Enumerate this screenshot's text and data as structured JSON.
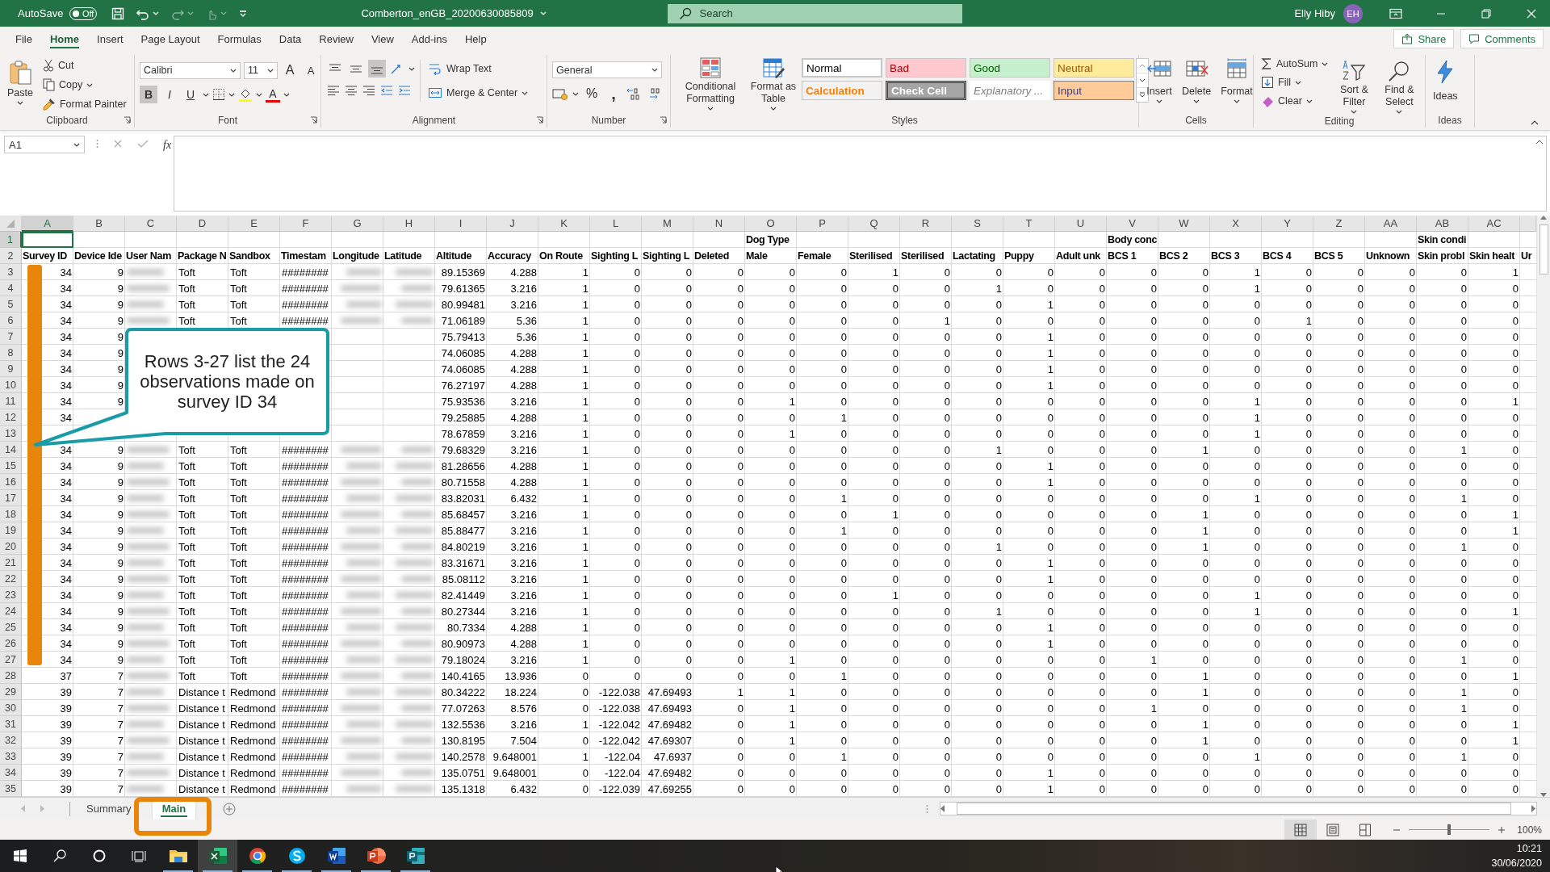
{
  "title_bar": {
    "autosave_label": "AutoSave",
    "autosave": {
      "label": "Off",
      "on": false
    },
    "file_name": "Comberton_enGB_20200630085809",
    "search": {
      "placeholder": "Search"
    },
    "user": {
      "name": "Elly Hiby",
      "initials": "EH"
    }
  },
  "tabs": [
    {
      "label": "File",
      "selected": false
    },
    {
      "label": "Home",
      "selected": true
    },
    {
      "label": "Insert",
      "selected": false
    },
    {
      "label": "Page Layout",
      "selected": false
    },
    {
      "label": "Formulas",
      "selected": false
    },
    {
      "label": "Data",
      "selected": false
    },
    {
      "label": "Review",
      "selected": false
    },
    {
      "label": "View",
      "selected": false
    },
    {
      "label": "Add-ins",
      "selected": false
    },
    {
      "label": "Help",
      "selected": false
    }
  ],
  "share_button": "Share",
  "comments_button": "Comments",
  "ribbon": {
    "groups": [
      {
        "kind": "clipboard",
        "label": "Clipboard",
        "paste": "Paste",
        "cut": "Cut",
        "copy": "Copy",
        "format_painter": "Format Painter"
      },
      {
        "kind": "font",
        "label": "Font",
        "font_name": "Calibri",
        "font_size": "11",
        "grow": "A",
        "shrink": "A",
        "format_buttons": [
          {
            "label": "B",
            "selected": true
          },
          {
            "label": "I",
            "selected": false
          },
          {
            "label": "U",
            "selected": false
          }
        ],
        "font_color": "A"
      },
      {
        "kind": "alignment",
        "label": "Alignment",
        "vertical_align": [
          {
            "selected": false
          },
          {
            "selected": false
          },
          {
            "selected": true
          }
        ],
        "wrap_text": "Wrap Text",
        "merge_center": "Merge & Center"
      },
      {
        "kind": "number",
        "label": "Number",
        "format": "General",
        "percent": "%",
        "comma": ","
      },
      {
        "kind": "styles",
        "label": "Styles",
        "conditional_formatting": "Conditional Formatting",
        "format_as_table": "Format as Table",
        "cell_styles": [
          {
            "label": "Normal",
            "color": "#ffffff"
          },
          {
            "label": "Bad",
            "color": "#ffc7ce"
          },
          {
            "label": "Good",
            "color": "#c6efce"
          },
          {
            "label": "Neutral",
            "color": "#ffeb9c"
          },
          {
            "label": "Calculation",
            "color": "#f2f2f2"
          },
          {
            "label": "Check Cell",
            "color": "#a5a5a5"
          },
          {
            "label": "Explanatory ...",
            "color": "#ffffff"
          },
          {
            "label": "Input",
            "color": "#ffcc99"
          }
        ]
      },
      {
        "kind": "cells",
        "label": "Cells",
        "buttons": [
          "Insert",
          "Delete",
          "Format"
        ]
      },
      {
        "kind": "editing",
        "label": "Editing",
        "autosum": "AutoSum",
        "fill": "Fill",
        "clear": "Clear",
        "sort_filter": "Sort & Filter",
        "find_select": "Find & Select"
      },
      {
        "kind": "ideas",
        "label": "Ideas",
        "button": "Ideas"
      }
    ]
  },
  "formula_bar": {
    "name_box": "A1",
    "fx": "fx"
  },
  "grid": {
    "columns": [
      {
        "letter": "A",
        "selected": true,
        "numeric": true
      },
      {
        "letter": "B",
        "selected": false,
        "numeric": true
      },
      {
        "letter": "C",
        "selected": false,
        "redacted": true
      },
      {
        "letter": "D",
        "selected": false,
        "numeric": false
      },
      {
        "letter": "E",
        "selected": false,
        "numeric": false
      },
      {
        "letter": "F",
        "selected": false,
        "numeric": false
      },
      {
        "letter": "G",
        "selected": false,
        "redacted": true,
        "numeric": true
      },
      {
        "letter": "H",
        "selected": false,
        "redacted": true,
        "numeric": true
      },
      {
        "letter": "I",
        "selected": false,
        "numeric": true
      },
      {
        "letter": "J",
        "selected": false,
        "numeric": true
      },
      {
        "letter": "K",
        "selected": false,
        "numeric": true
      },
      {
        "letter": "L",
        "selected": false,
        "numeric": true
      },
      {
        "letter": "M",
        "selected": false,
        "numeric": true
      },
      {
        "letter": "N",
        "selected": false,
        "numeric": true
      },
      {
        "letter": "O",
        "selected": false,
        "numeric": true
      },
      {
        "letter": "P",
        "selected": false,
        "numeric": true
      },
      {
        "letter": "Q",
        "selected": false,
        "numeric": true
      },
      {
        "letter": "R",
        "selected": false,
        "numeric": true
      },
      {
        "letter": "S",
        "selected": false,
        "numeric": true
      },
      {
        "letter": "T",
        "selected": false,
        "numeric": true
      },
      {
        "letter": "U",
        "selected": false,
        "numeric": true
      },
      {
        "letter": "V",
        "selected": false,
        "numeric": true
      },
      {
        "letter": "W",
        "selected": false,
        "numeric": true
      },
      {
        "letter": "X",
        "selected": false,
        "numeric": true
      },
      {
        "letter": "Y",
        "selected": false,
        "numeric": true
      },
      {
        "letter": "Z",
        "selected": false,
        "numeric": true
      },
      {
        "letter": "AA",
        "selected": false,
        "numeric": true
      },
      {
        "letter": "AB",
        "selected": false,
        "numeric": true
      },
      {
        "letter": "AC",
        "selected": false,
        "numeric": true
      },
      {
        "selected": false
      }
    ],
    "rows": [
      {
        "number": "1",
        "selected": true,
        "kind": "header",
        "cells": [
          null,
          null,
          null,
          null,
          null,
          null,
          null,
          null,
          null,
          null,
          null,
          null,
          null,
          null,
          "Dog Type",
          null,
          null,
          null,
          null,
          null,
          null,
          "Body conc",
          null,
          null,
          null,
          null,
          null,
          "Skin condi",
          null,
          null
        ]
      },
      {
        "number": "2",
        "selected": false,
        "kind": "header",
        "cells": [
          "Survey ID",
          "Device Ide",
          "User Nam",
          "Package N",
          "Sandbox",
          "Timestam",
          "Longitude",
          "Latitude",
          "Altitude",
          "Accuracy",
          "On Route",
          "Sighting L",
          "Sighting L",
          "Deleted",
          "Male",
          "Female",
          "Sterilised",
          "Sterilised",
          "Lactating",
          "Puppy",
          "Adult unk",
          "BCS 1",
          "BCS 2",
          "BCS 3",
          "BCS 4",
          "BCS 5",
          "Unknown",
          "Skin probl",
          "Skin healt",
          "Ur"
        ]
      },
      {
        "number": "3",
        "selected": false,
        "kind": "data",
        "cells": [
          "34",
          "9",
          null,
          "Toft",
          "Toft",
          "########",
          null,
          null,
          "89.15369",
          "4.288",
          "1",
          "0",
          "0",
          "0",
          "0",
          "0",
          "1",
          "0",
          "0",
          "0",
          "0",
          "0",
          "0",
          "1",
          "0",
          "0",
          "0",
          "0",
          "1",
          null
        ]
      },
      {
        "number": "4",
        "selected": false,
        "kind": "data",
        "cells": [
          "34",
          "9",
          null,
          "Toft",
          "Toft",
          "########",
          null,
          null,
          "79.61365",
          "3.216",
          "1",
          "0",
          "0",
          "0",
          "0",
          "0",
          "0",
          "0",
          "1",
          "0",
          "0",
          "0",
          "0",
          "1",
          "0",
          "0",
          "0",
          "0",
          "0",
          null
        ]
      },
      {
        "number": "5",
        "selected": false,
        "kind": "data",
        "cells": [
          "34",
          "9",
          null,
          "Toft",
          "Toft",
          "########",
          null,
          null,
          "80.99481",
          "3.216",
          "1",
          "0",
          "0",
          "0",
          "0",
          "0",
          "0",
          "0",
          "0",
          "1",
          "0",
          "0",
          "0",
          "0",
          "0",
          "0",
          "0",
          "0",
          "0",
          null
        ]
      },
      {
        "number": "6",
        "selected": false,
        "kind": "data",
        "cells": [
          "34",
          "9",
          null,
          "Toft",
          "Toft",
          "########",
          null,
          null,
          "71.06189",
          "5.36",
          "1",
          "0",
          "0",
          "0",
          "0",
          "0",
          "0",
          "1",
          "0",
          "0",
          "0",
          "0",
          "0",
          "0",
          "1",
          "0",
          "0",
          "0",
          "0",
          null
        ]
      },
      {
        "number": "7",
        "selected": false,
        "kind": "data",
        "cells": [
          "34",
          "9",
          null,
          null,
          null,
          null,
          null,
          null,
          "75.79413",
          "5.36",
          "1",
          "0",
          "0",
          "0",
          "0",
          "0",
          "0",
          "0",
          "0",
          "1",
          "0",
          "0",
          "0",
          "0",
          "0",
          "0",
          "0",
          "0",
          "0",
          null
        ]
      },
      {
        "number": "8",
        "selected": false,
        "kind": "data",
        "cells": [
          "34",
          "9",
          null,
          null,
          null,
          null,
          null,
          null,
          "74.06085",
          "4.288",
          "1",
          "0",
          "0",
          "0",
          "0",
          "0",
          "0",
          "0",
          "0",
          "1",
          "0",
          "0",
          "0",
          "0",
          "0",
          "0",
          "0",
          "0",
          "0",
          null
        ]
      },
      {
        "number": "9",
        "selected": false,
        "kind": "data",
        "cells": [
          "34",
          "9",
          null,
          null,
          null,
          null,
          null,
          null,
          "74.06085",
          "4.288",
          "1",
          "0",
          "0",
          "0",
          "0",
          "0",
          "0",
          "0",
          "0",
          "1",
          "0",
          "0",
          "0",
          "0",
          "0",
          "0",
          "0",
          "0",
          "0",
          null
        ]
      },
      {
        "number": "10",
        "selected": false,
        "kind": "data",
        "cells": [
          "34",
          "9",
          null,
          null,
          null,
          null,
          null,
          null,
          "76.27197",
          "4.288",
          "1",
          "0",
          "0",
          "0",
          "0",
          "0",
          "0",
          "0",
          "0",
          "1",
          "0",
          "0",
          "0",
          "0",
          "0",
          "0",
          "0",
          "0",
          "0",
          null
        ]
      },
      {
        "number": "11",
        "selected": false,
        "kind": "data",
        "cells": [
          "34",
          "9",
          null,
          null,
          null,
          null,
          null,
          null,
          "75.93536",
          "3.216",
          "1",
          "0",
          "0",
          "0",
          "1",
          "0",
          "0",
          "0",
          "0",
          "0",
          "0",
          "0",
          "0",
          "1",
          "0",
          "0",
          "0",
          "0",
          "1",
          null
        ]
      },
      {
        "number": "12",
        "selected": false,
        "kind": "data",
        "cells": [
          "34",
          null,
          null,
          null,
          null,
          null,
          null,
          null,
          "79.25885",
          "4.288",
          "1",
          "0",
          "0",
          "0",
          "0",
          "1",
          "0",
          "0",
          "0",
          "0",
          "0",
          "0",
          "0",
          "1",
          "0",
          "0",
          "0",
          "0",
          "0",
          null
        ]
      },
      {
        "number": "13",
        "selected": false,
        "kind": "data",
        "cells": [
          null,
          null,
          null,
          null,
          null,
          null,
          null,
          null,
          "78.67859",
          "3.216",
          "1",
          "0",
          "0",
          "0",
          "1",
          "0",
          "0",
          "0",
          "0",
          "0",
          "0",
          "0",
          "0",
          "1",
          "0",
          "0",
          "0",
          "0",
          "0",
          null
        ]
      },
      {
        "number": "14",
        "selected": false,
        "kind": "data",
        "cells": [
          "34",
          "9",
          null,
          "Toft",
          "Toft",
          "########",
          null,
          null,
          "79.68329",
          "3.216",
          "1",
          "0",
          "0",
          "0",
          "0",
          "0",
          "0",
          "0",
          "1",
          "0",
          "0",
          "0",
          "1",
          "0",
          "0",
          "0",
          "0",
          "1",
          "0",
          null
        ]
      },
      {
        "number": "15",
        "selected": false,
        "kind": "data",
        "cells": [
          "34",
          "9",
          null,
          "Toft",
          "Toft",
          "########",
          null,
          null,
          "81.28656",
          "4.288",
          "1",
          "0",
          "0",
          "0",
          "0",
          "0",
          "0",
          "0",
          "0",
          "1",
          "0",
          "0",
          "0",
          "0",
          "0",
          "0",
          "0",
          "0",
          "0",
          null
        ]
      },
      {
        "number": "16",
        "selected": false,
        "kind": "data",
        "cells": [
          "34",
          "9",
          null,
          "Toft",
          "Toft",
          "########",
          null,
          null,
          "80.71558",
          "4.288",
          "1",
          "0",
          "0",
          "0",
          "0",
          "0",
          "0",
          "0",
          "0",
          "1",
          "0",
          "0",
          "0",
          "0",
          "0",
          "0",
          "0",
          "0",
          "0",
          null
        ]
      },
      {
        "number": "17",
        "selected": false,
        "kind": "data",
        "cells": [
          "34",
          "9",
          null,
          "Toft",
          "Toft",
          "########",
          null,
          null,
          "83.82031",
          "6.432",
          "1",
          "0",
          "0",
          "0",
          "0",
          "1",
          "0",
          "0",
          "0",
          "0",
          "0",
          "0",
          "0",
          "1",
          "0",
          "0",
          "0",
          "1",
          "0",
          null
        ]
      },
      {
        "number": "18",
        "selected": false,
        "kind": "data",
        "cells": [
          "34",
          "9",
          null,
          "Toft",
          "Toft",
          "########",
          null,
          null,
          "85.68457",
          "3.216",
          "1",
          "0",
          "0",
          "0",
          "0",
          "0",
          "1",
          "0",
          "0",
          "0",
          "0",
          "0",
          "1",
          "0",
          "0",
          "0",
          "0",
          "0",
          "1",
          null
        ]
      },
      {
        "number": "19",
        "selected": false,
        "kind": "data",
        "cells": [
          "34",
          "9",
          null,
          "Toft",
          "Toft",
          "########",
          null,
          null,
          "85.88477",
          "3.216",
          "1",
          "0",
          "0",
          "0",
          "0",
          "1",
          "0",
          "0",
          "0",
          "0",
          "0",
          "0",
          "1",
          "0",
          "0",
          "0",
          "0",
          "0",
          "1",
          null
        ]
      },
      {
        "number": "20",
        "selected": false,
        "kind": "data",
        "cells": [
          "34",
          "9",
          null,
          "Toft",
          "Toft",
          "########",
          null,
          null,
          "84.80219",
          "3.216",
          "1",
          "0",
          "0",
          "0",
          "0",
          "0",
          "0",
          "0",
          "1",
          "0",
          "0",
          "0",
          "1",
          "0",
          "0",
          "0",
          "0",
          "1",
          "0",
          null
        ]
      },
      {
        "number": "21",
        "selected": false,
        "kind": "data",
        "cells": [
          "34",
          "9",
          null,
          "Toft",
          "Toft",
          "########",
          null,
          null,
          "83.31671",
          "3.216",
          "1",
          "0",
          "0",
          "0",
          "0",
          "0",
          "0",
          "0",
          "0",
          "1",
          "0",
          "0",
          "0",
          "0",
          "0",
          "0",
          "0",
          "0",
          "0",
          null
        ]
      },
      {
        "number": "22",
        "selected": false,
        "kind": "data",
        "cells": [
          "34",
          "9",
          null,
          "Toft",
          "Toft",
          "########",
          null,
          null,
          "85.08112",
          "3.216",
          "1",
          "0",
          "0",
          "0",
          "0",
          "0",
          "0",
          "0",
          "0",
          "1",
          "0",
          "0",
          "0",
          "0",
          "0",
          "0",
          "0",
          "0",
          "0",
          null
        ]
      },
      {
        "number": "23",
        "selected": false,
        "kind": "data",
        "cells": [
          "34",
          "9",
          null,
          "Toft",
          "Toft",
          "########",
          null,
          null,
          "82.41449",
          "3.216",
          "1",
          "0",
          "0",
          "0",
          "0",
          "0",
          "1",
          "0",
          "0",
          "0",
          "0",
          "0",
          "0",
          "1",
          "0",
          "0",
          "0",
          "0",
          "0",
          null
        ]
      },
      {
        "number": "24",
        "selected": false,
        "kind": "data",
        "cells": [
          "34",
          "9",
          null,
          "Toft",
          "Toft",
          "########",
          null,
          null,
          "80.27344",
          "3.216",
          "1",
          "0",
          "0",
          "0",
          "0",
          "0",
          "0",
          "0",
          "1",
          "0",
          "0",
          "0",
          "0",
          "1",
          "0",
          "0",
          "0",
          "0",
          "1",
          null
        ]
      },
      {
        "number": "25",
        "selected": false,
        "kind": "data",
        "cells": [
          "34",
          "9",
          null,
          "Toft",
          "Toft",
          "########",
          null,
          null,
          "80.7334",
          "4.288",
          "1",
          "0",
          "0",
          "0",
          "0",
          "0",
          "0",
          "0",
          "0",
          "1",
          "0",
          "0",
          "0",
          "0",
          "0",
          "0",
          "0",
          "0",
          "0",
          null
        ]
      },
      {
        "number": "26",
        "selected": false,
        "kind": "data",
        "cells": [
          "34",
          "9",
          null,
          "Toft",
          "Toft",
          "########",
          null,
          null,
          "80.90973",
          "4.288",
          "1",
          "0",
          "0",
          "0",
          "0",
          "0",
          "0",
          "0",
          "0",
          "1",
          "0",
          "0",
          "0",
          "0",
          "0",
          "0",
          "0",
          "0",
          "0",
          null
        ]
      },
      {
        "number": "27",
        "selected": false,
        "kind": "data",
        "cells": [
          "34",
          "9",
          null,
          "Toft",
          "Toft",
          "########",
          null,
          null,
          "79.18024",
          "3.216",
          "1",
          "0",
          "0",
          "0",
          "1",
          "0",
          "0",
          "0",
          "0",
          "0",
          "0",
          "1",
          "0",
          "0",
          "0",
          "0",
          "0",
          "1",
          "0",
          null
        ]
      },
      {
        "number": "28",
        "selected": false,
        "kind": "data",
        "cells": [
          "37",
          "7",
          null,
          "Toft",
          "Toft",
          "########",
          null,
          null,
          "140.4165",
          "13.936",
          "0",
          "0",
          "0",
          "0",
          "0",
          "1",
          "0",
          "0",
          "0",
          "0",
          "0",
          "0",
          "1",
          "0",
          "0",
          "0",
          "0",
          "0",
          "1",
          null
        ]
      },
      {
        "number": "29",
        "selected": false,
        "kind": "data",
        "cells": [
          "39",
          "7",
          null,
          "Distance t",
          "Redmond",
          "########",
          null,
          null,
          "80.34222",
          "18.224",
          "0",
          "-122.038",
          "47.69493",
          "1",
          "1",
          "0",
          "0",
          "0",
          "0",
          "0",
          "0",
          "0",
          "1",
          "0",
          "0",
          "0",
          "0",
          "1",
          "0",
          null
        ]
      },
      {
        "number": "30",
        "selected": false,
        "kind": "data",
        "cells": [
          "39",
          "7",
          null,
          "Distance t",
          "Redmond",
          "########",
          null,
          null,
          "77.07263",
          "8.576",
          "0",
          "-122.038",
          "47.69493",
          "0",
          "1",
          "0",
          "0",
          "0",
          "0",
          "0",
          "0",
          "1",
          "0",
          "0",
          "0",
          "0",
          "0",
          "1",
          "0",
          null
        ]
      },
      {
        "number": "31",
        "selected": false,
        "kind": "data",
        "cells": [
          "39",
          "7",
          null,
          "Distance t",
          "Redmond",
          "########",
          null,
          null,
          "132.5536",
          "3.216",
          "1",
          "-122.042",
          "47.69482",
          "0",
          "1",
          "0",
          "0",
          "0",
          "0",
          "0",
          "0",
          "0",
          "1",
          "0",
          "0",
          "0",
          "0",
          "0",
          "1",
          null
        ]
      },
      {
        "number": "32",
        "selected": false,
        "kind": "data",
        "cells": [
          "39",
          "7",
          null,
          "Distance t",
          "Redmond",
          "########",
          null,
          null,
          "130.8195",
          "7.504",
          "0",
          "-122.042",
          "47.69307",
          "0",
          "1",
          "0",
          "0",
          "0",
          "0",
          "0",
          "0",
          "0",
          "1",
          "0",
          "0",
          "0",
          "0",
          "0",
          "1",
          null
        ]
      },
      {
        "number": "33",
        "selected": false,
        "kind": "data",
        "cells": [
          "39",
          "7",
          null,
          "Distance t",
          "Redmond",
          "########",
          null,
          null,
          "140.2578",
          "9.648001",
          "1",
          "-122.04",
          "47.6937",
          "0",
          "0",
          "1",
          "0",
          "0",
          "0",
          "0",
          "0",
          "0",
          "0",
          "1",
          "0",
          "0",
          "0",
          "1",
          "0",
          null
        ]
      },
      {
        "number": "34",
        "selected": false,
        "kind": "data",
        "cells": [
          "39",
          "7",
          null,
          "Distance t",
          "Redmond",
          "########",
          null,
          null,
          "135.0751",
          "9.648001",
          "0",
          "-122.04",
          "47.69482",
          "0",
          "0",
          "0",
          "0",
          "0",
          "0",
          "1",
          "0",
          "0",
          "0",
          "0",
          "0",
          "0",
          "0",
          "0",
          "0",
          null
        ]
      },
      {
        "number": "35",
        "selected": false,
        "kind": "data",
        "cells": [
          "39",
          "7",
          null,
          "Distance t",
          "Redmond",
          "########",
          null,
          null,
          "135.1318",
          "6.432",
          "0",
          "-122.039",
          "47.69255",
          "0",
          "0",
          "0",
          "0",
          "0",
          "0",
          "1",
          "0",
          "0",
          "0",
          "0",
          "0",
          "0",
          "0",
          "0",
          "0",
          null
        ]
      }
    ]
  },
  "annotation": {
    "callout": "Rows 3-27 list the 24 observations made on survey ID 34"
  },
  "sheet_tabs": [
    {
      "label": "Summary",
      "selected": false
    },
    {
      "label": "Main",
      "selected": true
    }
  ],
  "status_bar": {
    "views": [
      {
        "selected": true
      },
      {
        "selected": false
      },
      {
        "selected": false
      }
    ],
    "zoom_slider": {
      "level": 0.5
    },
    "zoom": "100%"
  },
  "taskbar": {
    "apps": [
      {
        "kind": "explorer",
        "selected": false
      },
      {
        "kind": "excel",
        "selected": true
      },
      {
        "kind": "chrome",
        "selected": false
      },
      {
        "kind": "skype",
        "selected": false
      },
      {
        "kind": "word",
        "selected": false
      },
      {
        "kind": "powerpoint",
        "selected": false
      },
      {
        "kind": "project",
        "selected": false
      }
    ],
    "time": "10:21",
    "date": "30/06/2020"
  }
}
